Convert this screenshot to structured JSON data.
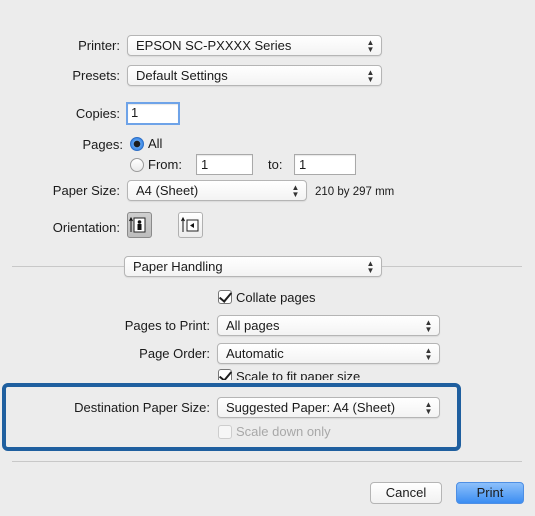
{
  "printer": {
    "label": "Printer:",
    "value": "EPSON SC-PXXXX Series"
  },
  "presets": {
    "label": "Presets:",
    "value": "Default Settings"
  },
  "copies": {
    "label": "Copies:",
    "value": "1"
  },
  "pages": {
    "label": "Pages:",
    "all_label": "All",
    "from_label": "From:",
    "from_value": "1",
    "to_label": "to:",
    "to_value": "1",
    "selected": "All"
  },
  "paper_size": {
    "label": "Paper Size:",
    "value": "A4 (Sheet)",
    "dimensions": "210 by 297 mm"
  },
  "orientation": {
    "label": "Orientation:",
    "selected": "portrait",
    "icons": [
      "portrait-icon",
      "landscape-icon"
    ]
  },
  "section": {
    "value": "Paper Handling"
  },
  "collate": {
    "label": "Collate pages",
    "checked": true
  },
  "pages_to_print": {
    "label": "Pages to Print:",
    "value": "All pages"
  },
  "page_order": {
    "label": "Page Order:",
    "value": "Automatic"
  },
  "scale_to_fit": {
    "label": "Scale to fit paper size",
    "checked": true
  },
  "destination": {
    "label": "Destination Paper Size:",
    "value": "Suggested Paper: A4 (Sheet)"
  },
  "scale_down": {
    "label": "Scale down only",
    "checked": false,
    "enabled": false
  },
  "buttons": {
    "cancel": "Cancel",
    "print": "Print"
  },
  "colors": {
    "accent": "#3b8df2",
    "highlight_border": "#1f5f9f",
    "background": "#ececec"
  }
}
